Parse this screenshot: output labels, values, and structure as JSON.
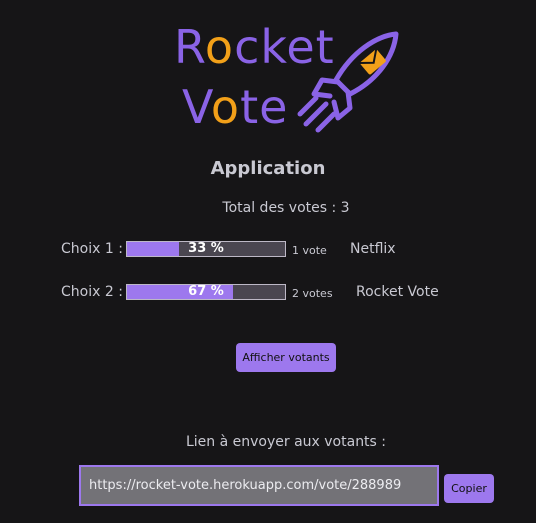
{
  "logo": {
    "line1_pre": "R",
    "line1_accent": "o",
    "line1_post": "cket",
    "line2_pre": "V",
    "line2_accent": "o",
    "line2_post": "te",
    "primary_color": "#8a63e6",
    "accent_color": "#f2a019",
    "icon": "rocket-envelope-icon"
  },
  "app": {
    "title": "Application",
    "total_label": "Total des votes : 3"
  },
  "choices": [
    {
      "label": "Choix 1 :",
      "percent_text": "33 %",
      "percent": 33,
      "votes_text": "1 vote",
      "name": "Netflix"
    },
    {
      "label": "Choix 2 :",
      "percent_text": "67 %",
      "percent": 67,
      "votes_text": "2 votes",
      "name": "Rocket Vote"
    }
  ],
  "buttons": {
    "show_voters": "Afficher votants",
    "copy": "Copier"
  },
  "share": {
    "label": "Lien à envoyer aux votants :",
    "url": "https://rocket-vote.herokuapp.com/vote/288989"
  },
  "colors": {
    "background": "#161517",
    "accent": "#9d78ee",
    "bar_track": "#4a4650",
    "text": "#c9c9d2"
  }
}
